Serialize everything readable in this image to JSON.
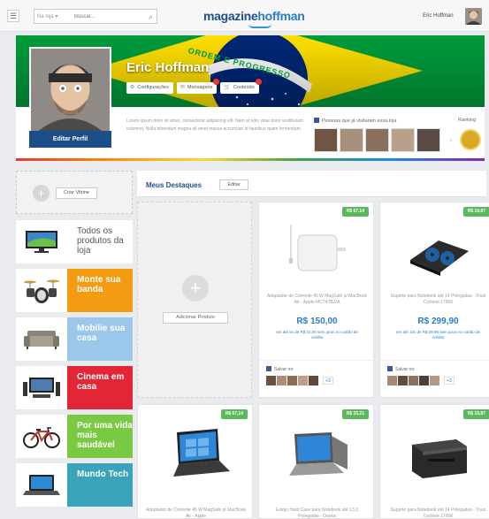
{
  "topbar": {
    "menu_icon": "☰",
    "search_scope": "Na loja ▾",
    "search_placeholder": "Buscar...",
    "search_icon": "⌕",
    "logo_part1": "magazine",
    "logo_part2": "hoffman",
    "user_name": "Eric Hoffman"
  },
  "profile": {
    "name": "Eric Hoffman",
    "edit_button": "Editar Perfil",
    "buttons": [
      {
        "icon": "⚙",
        "label": "Configurações",
        "notification": false
      },
      {
        "icon": "✉",
        "label": "Mensagens",
        "notification": true
      },
      {
        "icon": "🛒",
        "label": "Conteúdo",
        "notification": true
      }
    ],
    "bio": "Lorem ipsum dolor sit amet, consectetur adipiscing elit. Nam at odio vitae dolor vestibulum euismod. Nulla bibendum magna sit amet massa accumsan id faucibus quam fermentum.",
    "friends_title": "Pessoas que já visitaram essa loja",
    "friends_arrow": "›",
    "ranking_label": "Ranking",
    "banner_motto": "ORDEM E PROGRESSO"
  },
  "sidebar": {
    "create_label": "Criar Vitrine",
    "create_icon": "+",
    "categories": [
      {
        "label": "Todos os produtos da loja",
        "color": "#ffffff",
        "icon": "tv-icon"
      },
      {
        "label": "Monte sua banda",
        "color": "#f39c12",
        "icon": "drums-icon"
      },
      {
        "label": "Mobilie sua casa",
        "color": "#9ac7ea",
        "icon": "sofa-icon"
      },
      {
        "label": "Cinema em casa",
        "color": "#e32636",
        "icon": "home-theater-icon"
      },
      {
        "label": "Por uma vida mais saudável",
        "color": "#7ac943",
        "icon": "bicycle-icon"
      },
      {
        "label": "Mundo Tech",
        "color": "#3aa3b8",
        "icon": "laptop-icon"
      }
    ]
  },
  "main": {
    "title": "Meus Destaques",
    "edit_label": "Editar",
    "add_label": "Adicionar Produto",
    "add_icon": "+",
    "products": [
      {
        "badge": "R$ 67,14",
        "desc": "Adaptador de Corrente 45 W MagSafe p/ MacBook Air - Apple MC747BZ/A",
        "price": "R$ 150,00",
        "installments": "em até 5x de R$ 31,00 sem juros no cartão de crédito",
        "save_label": "Salvar no:",
        "plus": "+3",
        "image": "charger-icon"
      },
      {
        "badge": "R$ 19,87",
        "desc": "Suporte para Notebook até 14 Polegadas - Trust Cyclone 17806",
        "price": "R$ 299,90",
        "installments": "em até 10x de R$ 29,90 sem juros no cartão de crédito",
        "save_label": "Salvar no:",
        "plus": "+3",
        "image": "cooling-pad-icon"
      },
      {
        "badge": "R$ 67,14",
        "desc": "Adaptador de Corrente 45 W MagSafe p/ MacBook Air - Apple",
        "image": "laptop-icon"
      },
      {
        "badge": "R$ 33,21",
        "desc": "Estojo Hard Case para Notebook até 13,3 Polegadas - Danka",
        "image": "laptop-icon"
      },
      {
        "badge": "R$ 19,87",
        "desc": "Suporte para Notebook até 14 Polegadas - Trust Cyclone 17806",
        "image": "printer-icon"
      }
    ]
  }
}
